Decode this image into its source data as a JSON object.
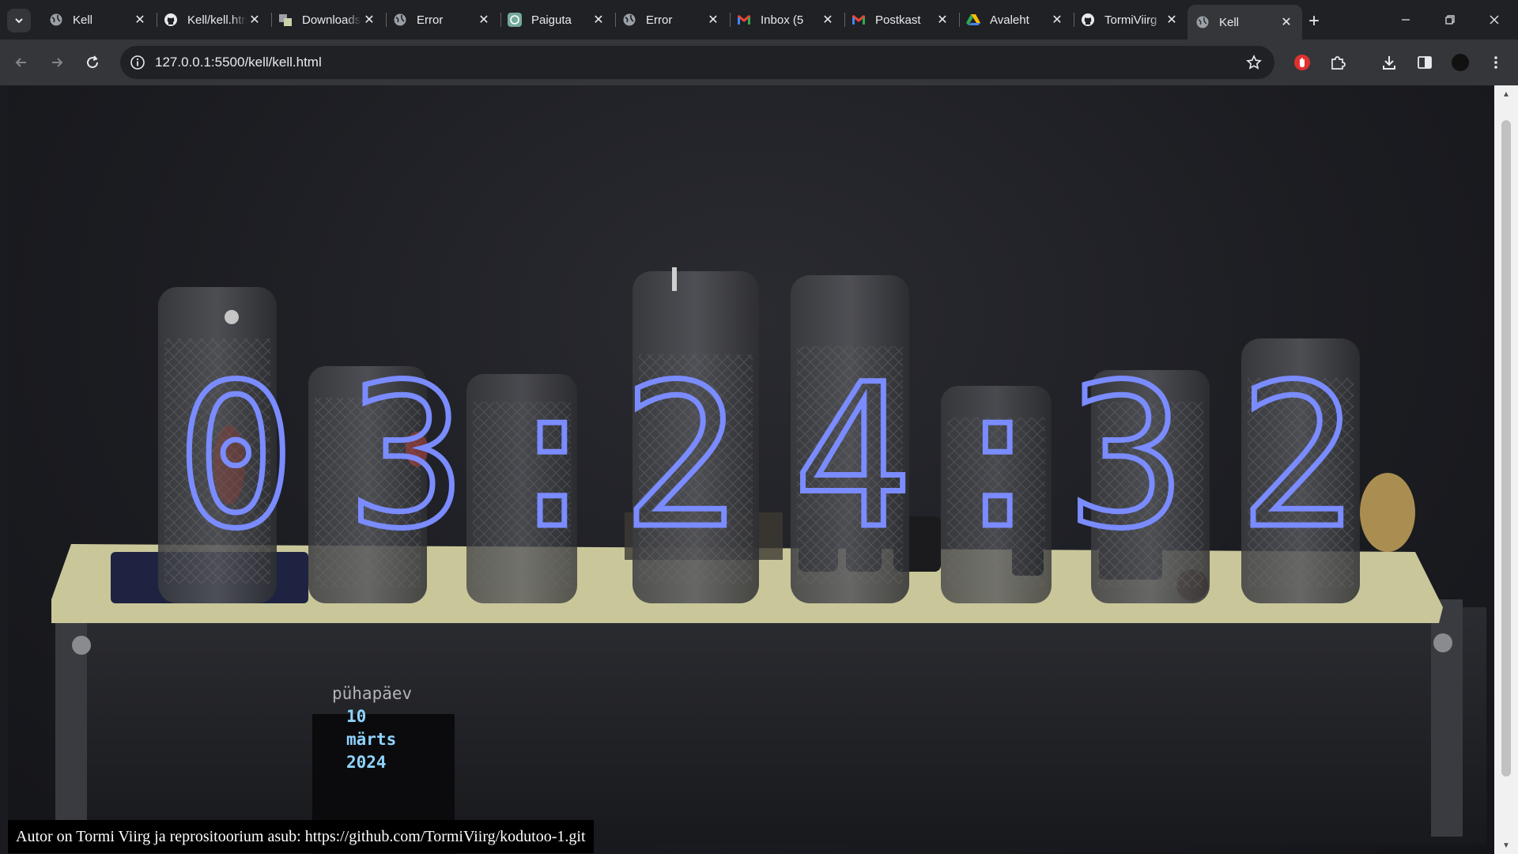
{
  "browser": {
    "tabs": [
      {
        "title": "Kell",
        "icon": "globe-icon",
        "active": false
      },
      {
        "title": "Kell/kell.html",
        "icon": "github-icon",
        "active": false
      },
      {
        "title": "Downloads",
        "icon": "downloads-icon",
        "active": false
      },
      {
        "title": "Error",
        "icon": "globe-icon",
        "active": false
      },
      {
        "title": "Paiguta",
        "icon": "chatgpt-icon",
        "active": false
      },
      {
        "title": "Error",
        "icon": "globe-icon",
        "active": false
      },
      {
        "title": "Inbox (5",
        "icon": "gmail-icon",
        "active": false
      },
      {
        "title": "Postkast",
        "icon": "gmail-icon",
        "active": false
      },
      {
        "title": "Avaleht",
        "icon": "drive-icon",
        "active": false
      },
      {
        "title": "TormiViirg",
        "icon": "github-icon",
        "active": false
      },
      {
        "title": "Kell",
        "icon": "globe-icon",
        "active": true
      }
    ],
    "url": "127.0.0.1:5500/kell/kell.html",
    "accent_color": "#35363a"
  },
  "clock": {
    "h1": "0",
    "h2": "3",
    "sep1": ":",
    "m1": "2",
    "m2": "4",
    "sep2": ":",
    "s1": "3",
    "s2": "2",
    "color": "#7a8cff"
  },
  "date": {
    "weekday": "pühapäev",
    "day": "10",
    "month": "märts",
    "year": "2024"
  },
  "footer": {
    "text": "Autor on Tormi Viirg ja reprositoorium asub: https://github.com/TormiViirg/kodutoo-1.git"
  }
}
